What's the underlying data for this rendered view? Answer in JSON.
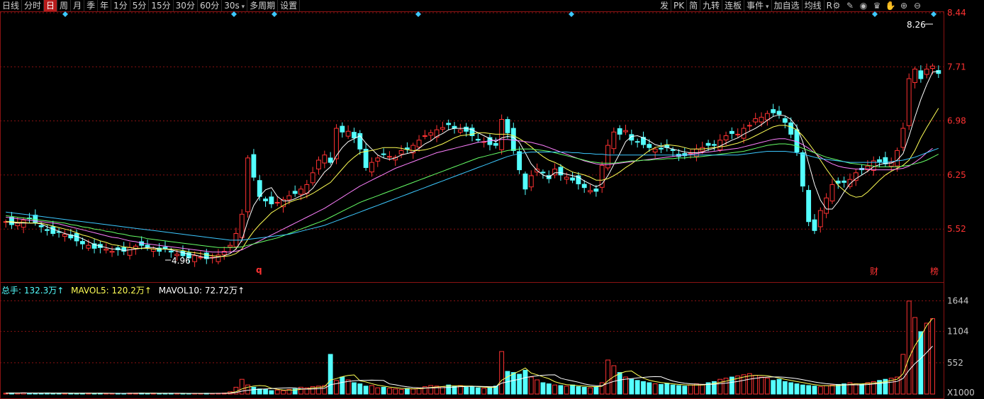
{
  "toolbar": {
    "items": [
      "日线",
      "分时",
      "日",
      "周",
      "月",
      "季",
      "年",
      "1分",
      "5分",
      "15分",
      "30分",
      "60分",
      "30s",
      "多周期",
      "设置"
    ],
    "active": "日",
    "right_items": [
      "发",
      "PK",
      "简",
      "九转",
      "连板",
      "事件",
      "加自选",
      "均线",
      "R"
    ]
  },
  "icons": [
    "settings-icon",
    "draw-pen-icon",
    "eye-icon",
    "mask-icon",
    "hand-icon",
    "zoom-in-icon",
    "zoom-out-icon"
  ],
  "price_axis": [
    "8.44",
    "7.71",
    "6.98",
    "6.25",
    "5.52"
  ],
  "vol_axis": [
    "1644",
    "1104",
    "552",
    "X1000"
  ],
  "labels": {
    "high": "8.26",
    "low": "4.96",
    "q": "q",
    "cai": "财",
    "bang": "榜"
  },
  "vol_legend": {
    "total": "总手: 132.3万↑",
    "mavol5": "MAVOL5: 120.2万↑",
    "mavol10": "MAVOL10: 72.72万↑"
  },
  "colors": {
    "up": "#ff3232",
    "down": "#54ffff",
    "ma5": "#ffffff",
    "ma10": "#ffff55",
    "ma20": "#ff80ff",
    "ma30": "#66ff66",
    "ma60": "#3cc8ff",
    "grid": "#8a1212"
  },
  "chart_data": {
    "type": "candlestick",
    "ylim": [
      4.9,
      8.44
    ],
    "vol_ylim": [
      0,
      1700
    ],
    "closes": [
      5.62,
      5.58,
      5.6,
      5.64,
      5.66,
      5.61,
      5.55,
      5.5,
      5.46,
      5.48,
      5.45,
      5.4,
      5.36,
      5.32,
      5.3,
      5.26,
      5.27,
      5.25,
      5.22,
      5.24,
      5.22,
      5.27,
      5.29,
      5.3,
      5.28,
      5.25,
      5.22,
      5.25,
      5.21,
      5.18,
      5.16,
      5.13,
      5.16,
      5.14,
      5.12,
      5.14,
      5.17,
      5.22,
      5.3,
      5.46,
      5.72,
      6.48,
      6.22,
      5.96,
      5.9,
      5.86,
      5.88,
      5.92,
      5.97,
      6.0,
      6.06,
      6.12,
      6.28,
      6.45,
      6.52,
      6.42,
      6.88,
      6.83,
      6.84,
      6.75,
      6.6,
      6.35,
      6.42,
      6.48,
      6.53,
      6.5,
      6.49,
      6.58,
      6.6,
      6.65,
      6.72,
      6.78,
      6.82,
      6.86,
      6.89,
      6.93,
      6.88,
      6.86,
      6.84,
      6.78,
      6.72,
      6.7,
      6.66,
      6.65,
      7.0,
      6.82,
      6.58,
      6.32,
      6.06,
      6.24,
      6.33,
      6.28,
      6.2,
      6.33,
      6.25,
      6.22,
      6.18,
      6.13,
      6.08,
      6.04,
      6.03,
      6.38,
      6.65,
      6.83,
      6.8,
      6.85,
      6.72,
      6.7,
      6.66,
      6.62,
      6.6,
      6.6,
      6.62,
      6.58,
      6.5,
      6.51,
      6.55,
      6.6,
      6.62,
      6.65,
      6.65,
      6.72,
      6.78,
      6.81,
      6.8,
      6.88,
      6.92,
      7.01,
      7.03,
      7.08,
      7.09,
      7.07,
      6.96,
      6.8,
      6.56,
      6.1,
      5.62,
      5.5,
      5.77,
      5.94,
      6.12,
      6.14,
      6.15,
      6.19,
      6.28,
      6.32,
      6.37,
      6.44,
      6.43,
      6.4,
      6.42,
      6.58,
      6.88,
      7.55,
      7.68,
      7.55,
      7.68,
      7.72,
      7.62
    ],
    "volumes": [
      15,
      20,
      18,
      22,
      16,
      14,
      18,
      20,
      14,
      16,
      12,
      14,
      12,
      14,
      16,
      12,
      14,
      10,
      12,
      14,
      12,
      16,
      14,
      18,
      12,
      14,
      12,
      10,
      14,
      12,
      10,
      12,
      10,
      12,
      14,
      12,
      14,
      18,
      40,
      120,
      260,
      160,
      120,
      90,
      80,
      60,
      70,
      60,
      80,
      90,
      120,
      110,
      130,
      140,
      150,
      700,
      240,
      300,
      250,
      200,
      180,
      140,
      150,
      110,
      120,
      100,
      90,
      80,
      100,
      90,
      110,
      130,
      150,
      140,
      130,
      160,
      140,
      150,
      120,
      130,
      110,
      100,
      120,
      140,
      750,
      400,
      380,
      350,
      420,
      300,
      250,
      200,
      180,
      160,
      150,
      140,
      160,
      130,
      120,
      110,
      130,
      200,
      600,
      500,
      380,
      300,
      260,
      240,
      220,
      200,
      180,
      170,
      190,
      160,
      150,
      140,
      160,
      180,
      170,
      200,
      220,
      260,
      280,
      300,
      320,
      340,
      360,
      330,
      300,
      280,
      240,
      260,
      220,
      200,
      180,
      160,
      150,
      140,
      130,
      150,
      160,
      170,
      180,
      200,
      180,
      170,
      200,
      220,
      240,
      260,
      280,
      300,
      700,
      1640,
      1350,
      1100,
      1250,
      1330
    ],
    "ma": [
      {
        "name": "MA5",
        "values": [
          5.62,
          5.61,
          5.6,
          5.6,
          5.6,
          5.6,
          5.59,
          5.55,
          5.52,
          5.49,
          5.46,
          5.44,
          5.42,
          5.39,
          5.35,
          5.31,
          5.29,
          5.27,
          5.25,
          5.25,
          5.23,
          5.24,
          5.25,
          5.26,
          5.27,
          5.27,
          5.25,
          5.25,
          5.24,
          5.22,
          5.2,
          5.18,
          5.17,
          5.15,
          5.13,
          5.13,
          5.14,
          5.16,
          5.19,
          5.25,
          5.37,
          5.63,
          5.84,
          5.96,
          6.05,
          6.08,
          5.96,
          5.9,
          5.9,
          5.93,
          5.97,
          6.0,
          6.07,
          6.18,
          6.29,
          6.36,
          6.51,
          6.62,
          6.7,
          6.74,
          6.78,
          6.68,
          6.6,
          6.52,
          6.48,
          6.46,
          6.48,
          6.52,
          6.54,
          6.56,
          6.61,
          6.67,
          6.71,
          6.77,
          6.81,
          6.86,
          6.88,
          6.88,
          6.88,
          6.86,
          6.82,
          6.78,
          6.74,
          6.7,
          6.75,
          6.77,
          6.76,
          6.69,
          6.55,
          6.4,
          6.31,
          6.25,
          6.22,
          6.28,
          6.28,
          6.26,
          6.24,
          6.22,
          6.17,
          6.13,
          6.09,
          6.13,
          6.24,
          6.39,
          6.54,
          6.7,
          6.77,
          6.78,
          6.75,
          6.71,
          6.66,
          6.64,
          6.62,
          6.6,
          6.58,
          6.56,
          6.55,
          6.55,
          6.56,
          6.59,
          6.61,
          6.64,
          6.68,
          6.72,
          6.75,
          6.8,
          6.84,
          6.88,
          6.93,
          6.99,
          7.04,
          7.06,
          7.05,
          7.0,
          6.9,
          6.7,
          6.41,
          6.12,
          5.91,
          5.79,
          5.79,
          5.89,
          6.02,
          6.13,
          6.2,
          6.25,
          6.3,
          6.36,
          6.39,
          6.41,
          6.41,
          6.45,
          6.54,
          6.77,
          7.03,
          7.27,
          7.47,
          7.64,
          7.65
        ],
        "color_key": "ma5"
      },
      {
        "name": "MA10",
        "values": [
          5.62,
          5.62,
          5.61,
          5.61,
          5.6,
          5.6,
          5.6,
          5.58,
          5.56,
          5.54,
          5.52,
          5.5,
          5.47,
          5.44,
          5.42,
          5.39,
          5.36,
          5.34,
          5.31,
          5.3,
          5.28,
          5.27,
          5.26,
          5.26,
          5.26,
          5.25,
          5.25,
          5.25,
          5.25,
          5.24,
          5.23,
          5.21,
          5.2,
          5.19,
          5.17,
          5.16,
          5.15,
          5.15,
          5.16,
          5.19,
          5.25,
          5.38,
          5.49,
          5.58,
          5.66,
          5.74,
          5.79,
          5.84,
          5.88,
          5.91,
          5.93,
          5.96,
          6.0,
          6.05,
          6.1,
          6.15,
          6.24,
          6.33,
          6.42,
          6.49,
          6.55,
          6.57,
          6.58,
          6.6,
          6.62,
          6.62,
          6.62,
          6.61,
          6.59,
          6.58,
          6.58,
          6.59,
          6.61,
          6.64,
          6.67,
          6.71,
          6.75,
          6.78,
          6.79,
          6.8,
          6.82,
          6.82,
          6.81,
          6.8,
          6.8,
          6.8,
          6.78,
          6.74,
          6.69,
          6.63,
          6.56,
          6.5,
          6.45,
          6.42,
          6.38,
          6.33,
          6.29,
          6.27,
          6.25,
          6.22,
          6.18,
          6.18,
          6.2,
          6.24,
          6.29,
          6.35,
          6.4,
          6.46,
          6.52,
          6.58,
          6.62,
          6.64,
          6.66,
          6.65,
          6.64,
          6.62,
          6.6,
          6.6,
          6.6,
          6.61,
          6.62,
          6.63,
          6.64,
          6.66,
          6.68,
          6.71,
          6.74,
          6.78,
          6.82,
          6.86,
          6.9,
          6.92,
          6.92,
          6.9,
          6.86,
          6.78,
          6.68,
          6.57,
          6.45,
          6.33,
          6.22,
          6.11,
          6.04,
          5.98,
          5.95,
          5.96,
          6.02,
          6.1,
          6.18,
          6.25,
          6.3,
          6.34,
          6.38,
          6.45,
          6.58,
          6.75,
          6.89,
          7.02,
          7.15
        ],
        "color_key": "ma10"
      },
      {
        "name": "MA20",
        "values": [
          5.68,
          5.67,
          5.66,
          5.65,
          5.64,
          5.63,
          5.62,
          5.61,
          5.6,
          5.59,
          5.57,
          5.55,
          5.53,
          5.51,
          5.49,
          5.47,
          5.45,
          5.43,
          5.41,
          5.4,
          5.38,
          5.36,
          5.35,
          5.33,
          5.32,
          5.31,
          5.3,
          5.29,
          5.28,
          5.27,
          5.26,
          5.25,
          5.24,
          5.23,
          5.22,
          5.21,
          5.21,
          5.21,
          5.21,
          5.22,
          5.24,
          5.28,
          5.32,
          5.36,
          5.4,
          5.44,
          5.48,
          5.52,
          5.56,
          5.6,
          5.64,
          5.68,
          5.72,
          5.76,
          5.8,
          5.85,
          5.9,
          5.95,
          6.0,
          6.05,
          6.1,
          6.14,
          6.18,
          6.22,
          6.26,
          6.3,
          6.34,
          6.37,
          6.4,
          6.43,
          6.46,
          6.49,
          6.52,
          6.55,
          6.57,
          6.59,
          6.61,
          6.63,
          6.65,
          6.67,
          6.69,
          6.7,
          6.71,
          6.72,
          6.73,
          6.73,
          6.72,
          6.71,
          6.7,
          6.69,
          6.67,
          6.65,
          6.62,
          6.59,
          6.56,
          6.53,
          6.5,
          6.47,
          6.44,
          6.42,
          6.4,
          6.39,
          6.39,
          6.4,
          6.41,
          6.42,
          6.43,
          6.44,
          6.45,
          6.46,
          6.47,
          6.48,
          6.49,
          6.5,
          6.51,
          6.52,
          6.53,
          6.54,
          6.55,
          6.56,
          6.57,
          6.58,
          6.59,
          6.6,
          6.61,
          6.63,
          6.65,
          6.67,
          6.69,
          6.71,
          6.73,
          6.74,
          6.74,
          6.72,
          6.7,
          6.66,
          6.61,
          6.55,
          6.49,
          6.44,
          6.4,
          6.37,
          6.35,
          6.34,
          6.33,
          6.33,
          6.33,
          6.32,
          6.32,
          6.32,
          6.32,
          6.33,
          6.34,
          6.37,
          6.42,
          6.48,
          6.55,
          6.61
        ],
        "color_key": "ma20"
      },
      {
        "name": "MA30",
        "values": [
          5.7,
          5.69,
          5.68,
          5.67,
          5.66,
          5.65,
          5.64,
          5.63,
          5.62,
          5.61,
          5.6,
          5.58,
          5.57,
          5.55,
          5.54,
          5.52,
          5.51,
          5.49,
          5.48,
          5.46,
          5.45,
          5.43,
          5.42,
          5.41,
          5.39,
          5.38,
          5.37,
          5.36,
          5.35,
          5.34,
          5.33,
          5.32,
          5.31,
          5.3,
          5.29,
          5.28,
          5.27,
          5.27,
          5.27,
          5.27,
          5.28,
          5.3,
          5.32,
          5.34,
          5.36,
          5.38,
          5.4,
          5.43,
          5.46,
          5.49,
          5.52,
          5.55,
          5.58,
          5.61,
          5.64,
          5.68,
          5.72,
          5.76,
          5.8,
          5.84,
          5.88,
          5.91,
          5.94,
          5.97,
          6.0,
          6.03,
          6.06,
          6.09,
          6.12,
          6.15,
          6.18,
          6.21,
          6.24,
          6.27,
          6.3,
          6.33,
          6.36,
          6.39,
          6.42,
          6.45,
          6.48,
          6.5,
          6.52,
          6.54,
          6.56,
          6.58,
          6.59,
          6.6,
          6.6,
          6.6,
          6.59,
          6.58,
          6.57,
          6.55,
          6.53,
          6.51,
          6.49,
          6.47,
          6.45,
          6.43,
          6.42,
          6.41,
          6.41,
          6.41,
          6.42,
          6.43,
          6.44,
          6.44,
          6.45,
          6.45,
          6.46,
          6.46,
          6.47,
          6.47,
          6.48,
          6.48,
          6.49,
          6.49,
          6.5,
          6.51,
          6.52,
          6.53,
          6.54,
          6.55,
          6.56,
          6.57,
          6.59,
          6.61,
          6.63,
          6.65,
          6.66,
          6.67,
          6.67,
          6.66,
          6.64,
          6.61,
          6.58,
          6.55,
          6.52,
          6.49,
          6.47,
          6.45,
          6.43,
          6.41,
          6.4,
          6.39,
          6.38,
          6.37,
          6.36,
          6.36,
          6.36,
          6.36,
          6.37,
          6.38,
          6.4,
          6.42,
          6.45,
          6.49,
          6.53
        ],
        "color_key": "ma30"
      },
      {
        "name": "MA60",
        "values": [
          5.75,
          5.74,
          5.73,
          5.72,
          5.71,
          5.7,
          5.69,
          5.68,
          5.67,
          5.66,
          5.65,
          5.64,
          5.63,
          5.62,
          5.61,
          5.6,
          5.59,
          5.58,
          5.57,
          5.56,
          5.55,
          5.54,
          5.53,
          5.52,
          5.51,
          5.5,
          5.49,
          5.48,
          5.47,
          5.46,
          5.45,
          5.44,
          5.43,
          5.42,
          5.41,
          5.4,
          5.39,
          5.38,
          5.37,
          5.37,
          5.37,
          5.38,
          5.39,
          5.4,
          5.41,
          5.42,
          5.43,
          5.44,
          5.45,
          5.47,
          5.49,
          5.51,
          5.53,
          5.55,
          5.57,
          5.6,
          5.63,
          5.66,
          5.69,
          5.72,
          5.75,
          5.78,
          5.81,
          5.84,
          5.87,
          5.9,
          5.93,
          5.96,
          5.99,
          6.02,
          6.05,
          6.08,
          6.11,
          6.14,
          6.17,
          6.2,
          6.23,
          6.26,
          6.29,
          6.32,
          6.35,
          6.38,
          6.41,
          6.44,
          6.47,
          6.5,
          6.52,
          6.54,
          6.55,
          6.56,
          6.56,
          6.56,
          6.56,
          6.56,
          6.56,
          6.56,
          6.55,
          6.55,
          6.54,
          6.54,
          6.53,
          6.53,
          6.52,
          6.52,
          6.52,
          6.52,
          6.52,
          6.52,
          6.52,
          6.52,
          6.52,
          6.52,
          6.52,
          6.52,
          6.52,
          6.52,
          6.52,
          6.52,
          6.52,
          6.52,
          6.52,
          6.52,
          6.52,
          6.52,
          6.52,
          6.53,
          6.54,
          6.55,
          6.56,
          6.57,
          6.57,
          6.57,
          6.57,
          6.56,
          6.55,
          6.53,
          6.51,
          6.49,
          6.47,
          6.46,
          6.45,
          6.44,
          6.43,
          6.42,
          6.42,
          6.42,
          6.42,
          6.42,
          6.42,
          6.42,
          6.43,
          6.44,
          6.45,
          6.47,
          6.49,
          6.52,
          6.55,
          6.58,
          6.61
        ],
        "color_key": "ma60"
      }
    ]
  }
}
